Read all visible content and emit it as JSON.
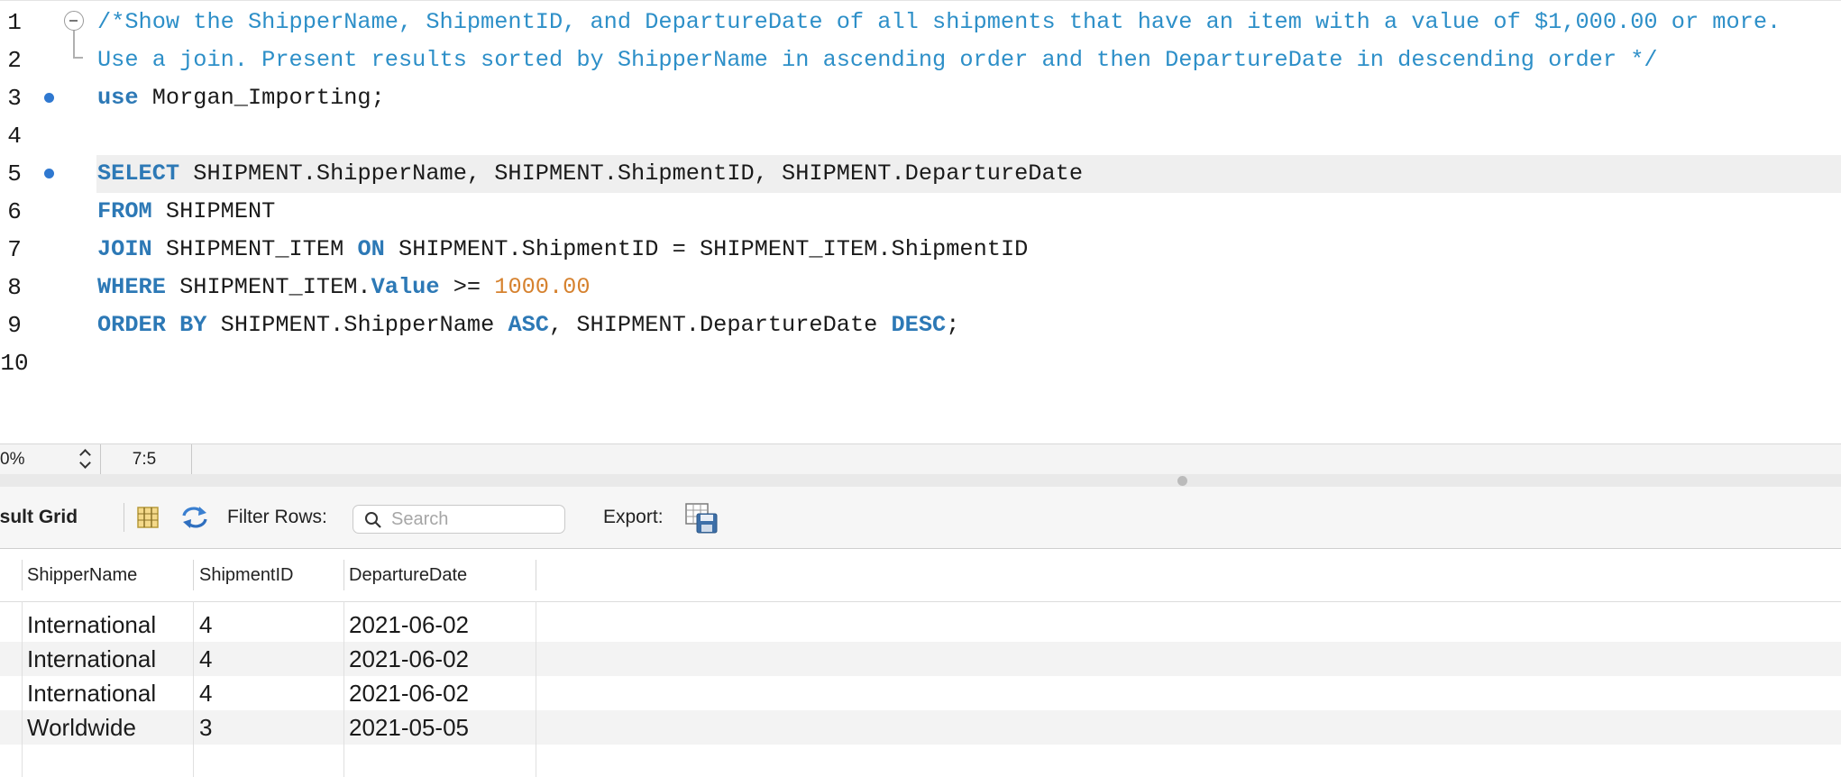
{
  "editor": {
    "lines": [
      {
        "num": "1",
        "segments": [
          {
            "t": "/*Show the ShipperName, ShipmentID, and DepartureDate of all shipments that have an item with a value of $1,000.00 or more.",
            "c": "cm"
          }
        ]
      },
      {
        "num": "2",
        "segments": [
          {
            "t": "Use a join. Present results sorted by ShipperName in ascending order and then DepartureDate in descending order */",
            "c": "cm"
          }
        ]
      },
      {
        "num": "3",
        "segments": [
          {
            "t": "use",
            "c": "kw"
          },
          {
            "t": " Morgan_Importing;",
            "c": ""
          }
        ]
      },
      {
        "num": "4",
        "segments": []
      },
      {
        "num": "5",
        "segments": [
          {
            "t": "SELECT",
            "c": "kw"
          },
          {
            "t": " SHIPMENT.ShipperName, SHIPMENT.ShipmentID, SHIPMENT.DepartureDate",
            "c": ""
          }
        ]
      },
      {
        "num": "6",
        "segments": [
          {
            "t": "FROM",
            "c": "kw"
          },
          {
            "t": " SHIPMENT",
            "c": ""
          }
        ]
      },
      {
        "num": "7",
        "segments": [
          {
            "t": "JOIN",
            "c": "kw"
          },
          {
            "t": " SHIPMENT_ITEM ",
            "c": ""
          },
          {
            "t": "ON",
            "c": "kw"
          },
          {
            "t": " SHIPMENT.ShipmentID = SHIPMENT_ITEM.ShipmentID",
            "c": ""
          }
        ]
      },
      {
        "num": "8",
        "segments": [
          {
            "t": "WHERE",
            "c": "kw"
          },
          {
            "t": " SHIPMENT_ITEM.",
            "c": ""
          },
          {
            "t": "Value",
            "c": "kw"
          },
          {
            "t": " >= ",
            "c": ""
          },
          {
            "t": "1000.00",
            "c": "num"
          }
        ]
      },
      {
        "num": "9",
        "segments": [
          {
            "t": "ORDER BY",
            "c": "kw"
          },
          {
            "t": " SHIPMENT.ShipperName ",
            "c": ""
          },
          {
            "t": "ASC",
            "c": "kw"
          },
          {
            "t": ", SHIPMENT.DepartureDate ",
            "c": ""
          },
          {
            "t": "DESC",
            "c": "kw"
          },
          {
            "t": ";",
            "c": ""
          }
        ]
      },
      {
        "num": "10",
        "segments": []
      }
    ]
  },
  "statusbar": {
    "zoom": "0%",
    "cursor_position": "7:5"
  },
  "result_toolbar": {
    "title": "esult Grid",
    "filter_label": "Filter Rows:",
    "search_placeholder": "Search",
    "export_label": "Export:"
  },
  "grid": {
    "columns": [
      "ShipperName",
      "ShipmentID",
      "DepartureDate"
    ],
    "rows": [
      [
        "International",
        "4",
        "2021-06-02"
      ],
      [
        "International",
        "4",
        "2021-06-02"
      ],
      [
        "International",
        "4",
        "2021-06-02"
      ],
      [
        "Worldwide",
        "3",
        "2021-05-05"
      ]
    ]
  },
  "colors": {
    "keyword": "#2d79b6",
    "comment": "#2d8fc8",
    "number": "#d6822f",
    "breakpoint": "#2f78d0",
    "current_line": "#efefef"
  }
}
